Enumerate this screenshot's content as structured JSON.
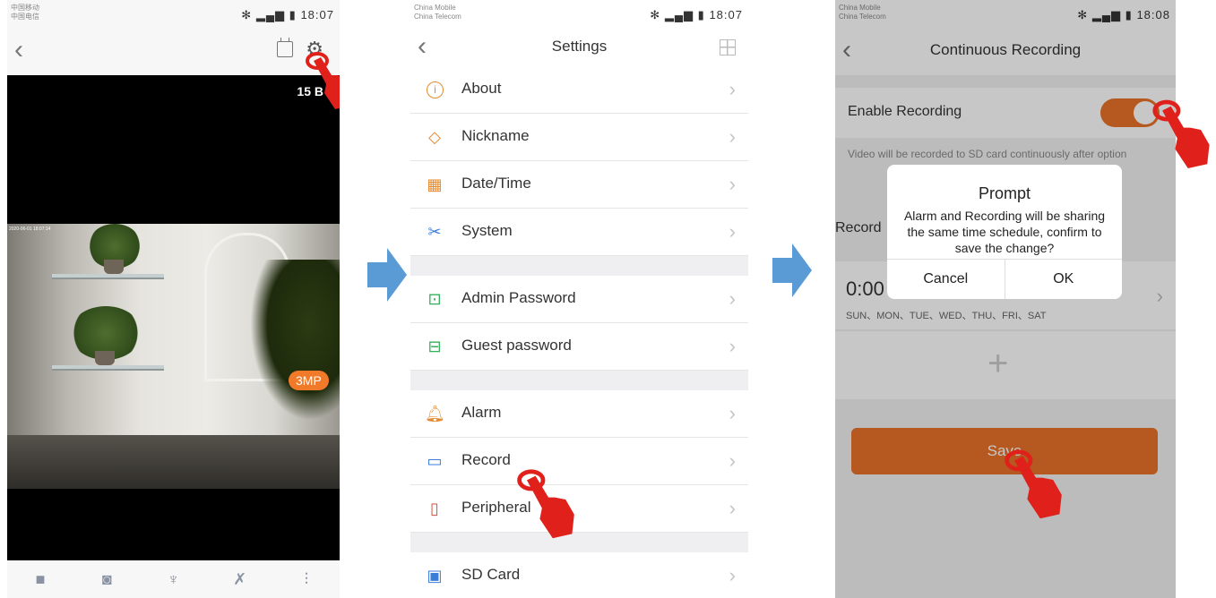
{
  "phone1": {
    "carrier": [
      "中国移动",
      "中国电信"
    ],
    "time": "18:07",
    "data_rate": "15 B",
    "resolution_badge": "3MP",
    "osd_text": "2020-06-01 18:07:14"
  },
  "phone2": {
    "carrier": [
      "China Mobile",
      "China Telecom"
    ],
    "time": "18:07",
    "title": "Settings",
    "items": [
      {
        "label": "About",
        "icon": "info-icon"
      },
      {
        "label": "Nickname",
        "icon": "tag-icon"
      },
      {
        "label": "Date/Time",
        "icon": "calendar-icon"
      },
      {
        "label": "System",
        "icon": "tools-icon"
      },
      {
        "label": "Admin Password",
        "icon": "lock-icon"
      },
      {
        "label": "Guest password",
        "icon": "lock-icon"
      },
      {
        "label": "Alarm",
        "icon": "bell-icon"
      },
      {
        "label": "Record",
        "icon": "video-icon"
      },
      {
        "label": "Peripheral",
        "icon": "device-icon"
      },
      {
        "label": "SD Card",
        "icon": "sd-card-icon"
      }
    ]
  },
  "phone3": {
    "carrier": [
      "China Mobile",
      "China Telecom"
    ],
    "time": "18:08",
    "title": "Continuous Recording",
    "enable_label": "Enable Recording",
    "enable_state": true,
    "description": "Video will be recorded to SD card continuously after option",
    "record_section": "Record",
    "schedule_time": "0:00",
    "schedule_days": "SUN、MON、TUE、WED、THU、FRI、SAT",
    "save_label": "Save",
    "dialog": {
      "title": "Prompt",
      "message": "Alarm and Recording will be sharing the same time schedule, confirm to save the change?",
      "cancel": "Cancel",
      "ok": "OK"
    }
  },
  "colors": {
    "accent": "#e8722a",
    "arrow": "#5b9bd5",
    "hand": "#e0211b"
  }
}
